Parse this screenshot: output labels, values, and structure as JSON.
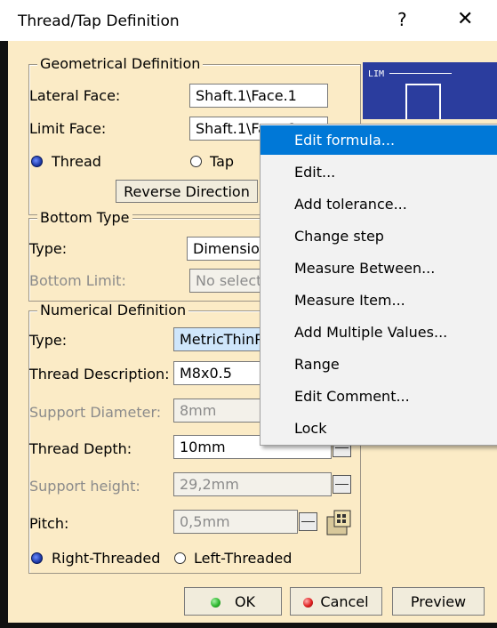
{
  "window": {
    "title": "Thread/Tap Definition",
    "help": "?",
    "close": "✕"
  },
  "geometrical": {
    "legend": "Geometrical Definition",
    "lateral_label": "Lateral Face:",
    "lateral_value": "Shaft.1\\Face.1",
    "limit_label": "Limit Face:",
    "limit_value": "Shaft.1\\Face.2",
    "thread_label": "Thread",
    "tap_label": "Tap",
    "reverse_button": "Reverse Direction",
    "preview_text": "LIM"
  },
  "bottom": {
    "legend": "Bottom Type",
    "type_label": "Type:",
    "type_value": "Dimension",
    "limit_label": "Bottom Limit:",
    "limit_value": "No selection"
  },
  "numerical": {
    "legend": "Numerical Definition",
    "type_label": "Type:",
    "type_value": "MetricThinPitch",
    "desc_label": "Thread Description:",
    "desc_value": "M8x0.5",
    "support_diam_label": "Support Diameter:",
    "support_diam_value": "8mm",
    "depth_label": "Thread Depth:",
    "depth_value": "10mm",
    "support_height_label": "Support height:",
    "support_height_value": "29,2mm",
    "pitch_label": "Pitch:",
    "pitch_value": "0,5mm",
    "right_label": "Right-Threaded",
    "left_label": "Left-Threaded"
  },
  "buttons": {
    "ok": "OK",
    "cancel": "Cancel",
    "preview": "Preview"
  },
  "context_menu": [
    {
      "label": "Edit formula..."
    },
    {
      "label": "Edit..."
    },
    {
      "label": "Add tolerance..."
    },
    {
      "label": "Change step"
    },
    {
      "label": "Measure Between..."
    },
    {
      "label": "Measure Item..."
    },
    {
      "label": "Add Multiple Values..."
    },
    {
      "label": "Range"
    },
    {
      "label": "Edit Comment..."
    },
    {
      "label": "Lock"
    }
  ],
  "colors": {
    "dialog_bg": "#fbebc6",
    "highlight": "#0078d7",
    "ok_dot": "#2fb82f",
    "cancel_dot": "#e02020"
  }
}
